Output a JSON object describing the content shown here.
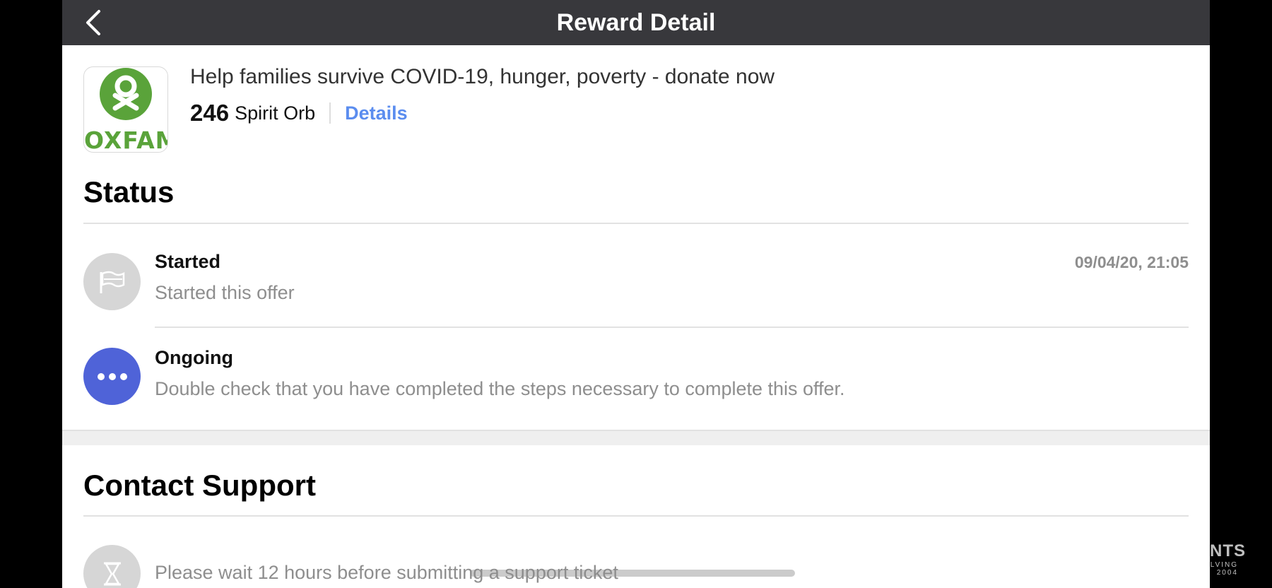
{
  "header": {
    "title": "Reward Detail"
  },
  "offer": {
    "logo_text": "OXFAM",
    "title": "Help families survive COVID-19, hunger, poverty - donate now",
    "points": "246",
    "points_unit": "Spirit Orb",
    "details_label": "Details"
  },
  "status": {
    "heading": "Status",
    "items": [
      {
        "title": "Started",
        "description": "Started this offer",
        "timestamp": "09/04/20, 21:05",
        "icon": "flag-icon",
        "color": "#d6d6d6"
      },
      {
        "title": "Ongoing",
        "description": "Double check that you have completed the steps necessary to complete this offer.",
        "timestamp": "",
        "icon": "more-dots-icon",
        "color": "#4f63d8"
      }
    ]
  },
  "support": {
    "heading": "Contact Support",
    "message": "Please wait 12 hours before submitting a support ticket",
    "icon": "hourglass-icon"
  },
  "watermark": {
    "line1": "NTS",
    "line2": "LVING",
    "line3": "2004"
  },
  "colors": {
    "topbar": "#38383c",
    "accent": "#5b8def",
    "ongoing": "#4f63d8",
    "oxfam_green": "#5aa33a"
  }
}
